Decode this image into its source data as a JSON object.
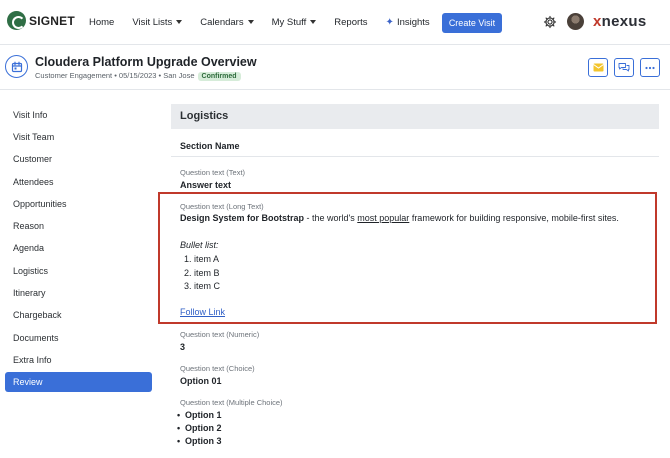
{
  "nav": {
    "logo": "SIGNET",
    "links": [
      "Home",
      "Visit Lists",
      "Calendars",
      "My Stuff",
      "Reports",
      "Insights"
    ],
    "create_button": "Create Visit",
    "brand": "nexus",
    "brand_mark": "x"
  },
  "header": {
    "title": "Cloudera Platform Upgrade Overview",
    "subtitle": "Customer Engagement • 05/15/2023 • San Jose",
    "status": "Confirmed"
  },
  "sidebar": {
    "items": [
      "Visit Info",
      "Visit Team",
      "Customer",
      "Attendees",
      "Opportunities",
      "Reason",
      "Agenda",
      "Logistics",
      "Itinerary",
      "Chargeback",
      "Documents",
      "Extra Info",
      "Review"
    ],
    "active": "Review"
  },
  "main": {
    "section_title": "Logistics",
    "section_name": "Section Name",
    "q_text": {
      "label": "Question text (Text)",
      "answer": "Answer text"
    },
    "q_long": {
      "label": "Question text (Long Text)",
      "bold": "Design System for Bootstrap",
      "pre": " - the world's ",
      "underline": "most popular",
      "post": " framework for building responsive, mobile-first sites.",
      "bullet_label": "Bullet list:",
      "list": [
        "1.  item A",
        "2.  item B",
        "3.  item C"
      ],
      "link": "Follow Link"
    },
    "q_numeric": {
      "label": "Question text (Numeric)",
      "answer": "3"
    },
    "q_choice": {
      "label": "Question text (Choice)",
      "answer": "Option 01"
    },
    "q_multi": {
      "label": "Question text (Multiple Choice)",
      "options": [
        "Option 1",
        "Option 2",
        "Option 3"
      ]
    }
  },
  "colors": {
    "accent": "#3a6fd8",
    "highlight": "#c0392b",
    "badge_bg": "#d6ecd9"
  }
}
